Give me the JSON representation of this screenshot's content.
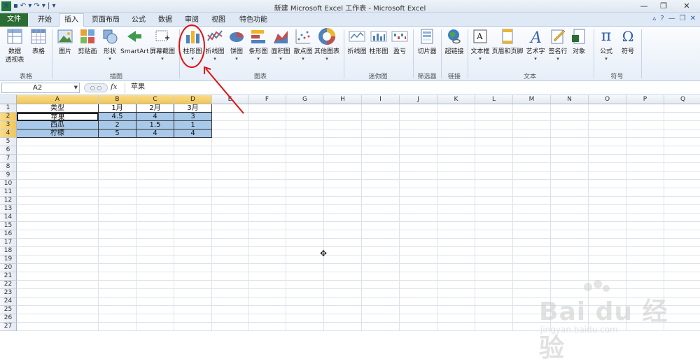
{
  "window": {
    "title": "新建 Microsoft Excel 工作表 - Microsoft Excel"
  },
  "qat": {
    "logo": "X",
    "save": "▪",
    "undo": "↶ ▾",
    "redo": "↷ ▾",
    "more": "| ▾"
  },
  "window_buttons": {
    "minimize": "—",
    "restore": "❐",
    "close": "✕"
  },
  "tabs": [
    "文件",
    "开始",
    "插入",
    "页面布局",
    "公式",
    "数据",
    "审阅",
    "视图",
    "特色功能"
  ],
  "tab_icons": {
    "collapse": "▵",
    "help": "?",
    "min": "—",
    "restore": "❐",
    "close": "✕"
  },
  "ribbon": {
    "groups": [
      "表格",
      "插图",
      "图表",
      "迷你图",
      "筛选器",
      "链接",
      "文本",
      "符号"
    ],
    "buttons": {
      "pivot1": "数据",
      "pivot2": "透视表",
      "table": "表格",
      "picture": "图片",
      "clipart": "剪贴画",
      "shapes": "形状",
      "smartart": "SmartArt",
      "screenshot": "屏幕截图",
      "column": "柱形图",
      "line": "折线图",
      "pie": "饼图",
      "bar": "条形图",
      "area": "面积图",
      "scatter": "散点图",
      "other": "其他图表",
      "spark_line": "折线图",
      "spark_col": "柱形图",
      "spark_wl": "盈亏",
      "slicer": "切片器",
      "hyperlink": "超链接",
      "textbox": "文本框",
      "headerfooter": "页眉和页脚",
      "wordart": "艺术字",
      "signature": "签名行",
      "object": "对象",
      "equation": "公式",
      "symbol": "符号"
    },
    "icons": {
      "equation": "π",
      "symbol": "Ω",
      "wordart": "A",
      "textbox": "A"
    }
  },
  "formula_bar": {
    "name_box": "A2",
    "fx": "fx",
    "value": "苹果"
  },
  "columns": [
    "A",
    "B",
    "C",
    "D",
    "E",
    "F",
    "G",
    "H",
    "I",
    "J",
    "K",
    "L",
    "M",
    "N",
    "O",
    "P",
    "Q"
  ],
  "rows": [
    "1",
    "2",
    "3",
    "4",
    "5",
    "6",
    "7",
    "8",
    "9",
    "10",
    "11",
    "12",
    "13",
    "14",
    "15",
    "16",
    "17",
    "18",
    "19",
    "20",
    "21",
    "22",
    "23",
    "24",
    "25",
    "26",
    "27"
  ],
  "sheet": [
    [
      "类型",
      "1月",
      "2月",
      "3月"
    ],
    [
      "苹果",
      "4.5",
      "4",
      "3"
    ],
    [
      "西瓜",
      "2",
      "1.5",
      "1"
    ],
    [
      "柠檬",
      "5",
      "4",
      "4"
    ]
  ],
  "watermark": {
    "big": "Bai du 经验",
    "small": "jingyan.baidu.com"
  },
  "colors": {
    "accent": "#2b6d33",
    "selection": "#a9c9ea",
    "annotation": "#e01010"
  }
}
